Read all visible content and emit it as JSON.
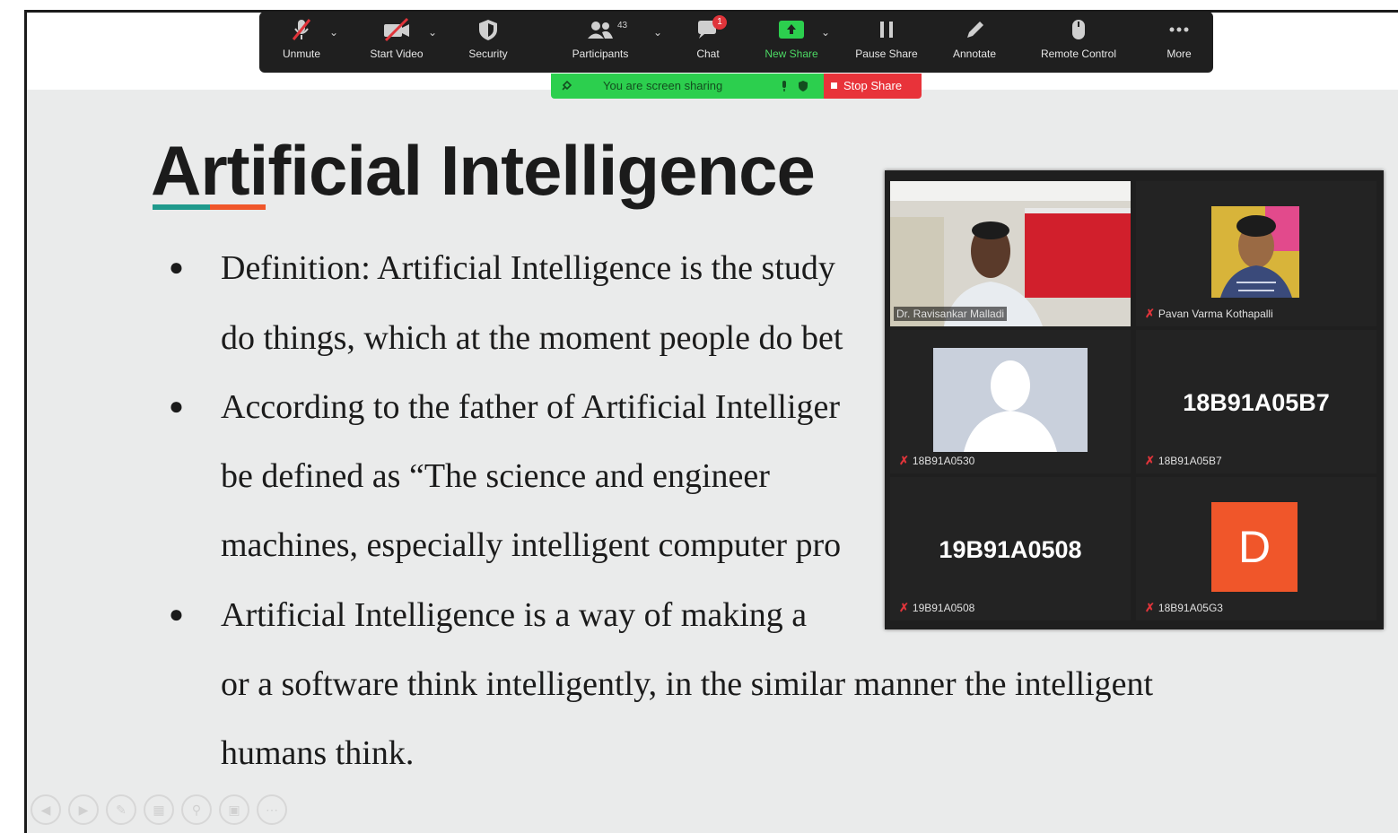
{
  "toolbar": {
    "items": [
      {
        "label": "Unmute",
        "icon": "mic-muted-icon"
      },
      {
        "label": "Start Video",
        "icon": "video-off-icon"
      },
      {
        "label": "Security",
        "icon": "shield-icon"
      },
      {
        "label": "Participants",
        "icon": "participants-icon",
        "count": "43"
      },
      {
        "label": "Chat",
        "icon": "chat-icon",
        "badge": "1"
      },
      {
        "label": "New Share",
        "icon": "share-screen-icon"
      },
      {
        "label": "Pause Share",
        "icon": "pause-icon"
      },
      {
        "label": "Annotate",
        "icon": "pencil-icon"
      },
      {
        "label": "Remote Control",
        "icon": "mouse-icon"
      },
      {
        "label": "More",
        "icon": "more-icon"
      }
    ],
    "accent_green": "#4cd964"
  },
  "share_banner": {
    "text": "You are screen sharing",
    "stop_label": "Stop Share",
    "bg": "#2ccf4e",
    "stop_bg": "#e8333a"
  },
  "slide": {
    "title": "Artificial Intelligence",
    "lines": [
      "Definition: Artificial Intelligence is the study",
      "do things, which at the moment people do bet",
      "According to the father of Artificial Intelliger",
      "be  defined  as  “The  science  and  engineer",
      "machines, especially intelligent computer pro",
      "Artificial  Intelligence  is  a  way  of  making  a",
      "or  a  software  think  intelligently,  in  the  similar  manner  the  intelligent",
      "humans think."
    ]
  },
  "gallery": {
    "tiles": [
      {
        "name": "Dr. Ravisankar Malladi",
        "type": "video"
      },
      {
        "name": "Pavan Varma Kothapalli",
        "type": "photo"
      },
      {
        "name": "18B91A0530",
        "type": "silhouette"
      },
      {
        "name": "18B91A05B7",
        "display": "18B91A05B7",
        "type": "text"
      },
      {
        "name": "19B91A0508",
        "display": "19B91A0508",
        "type": "text"
      },
      {
        "name": "18B91A05G3",
        "display": "D",
        "type": "letter"
      }
    ]
  }
}
